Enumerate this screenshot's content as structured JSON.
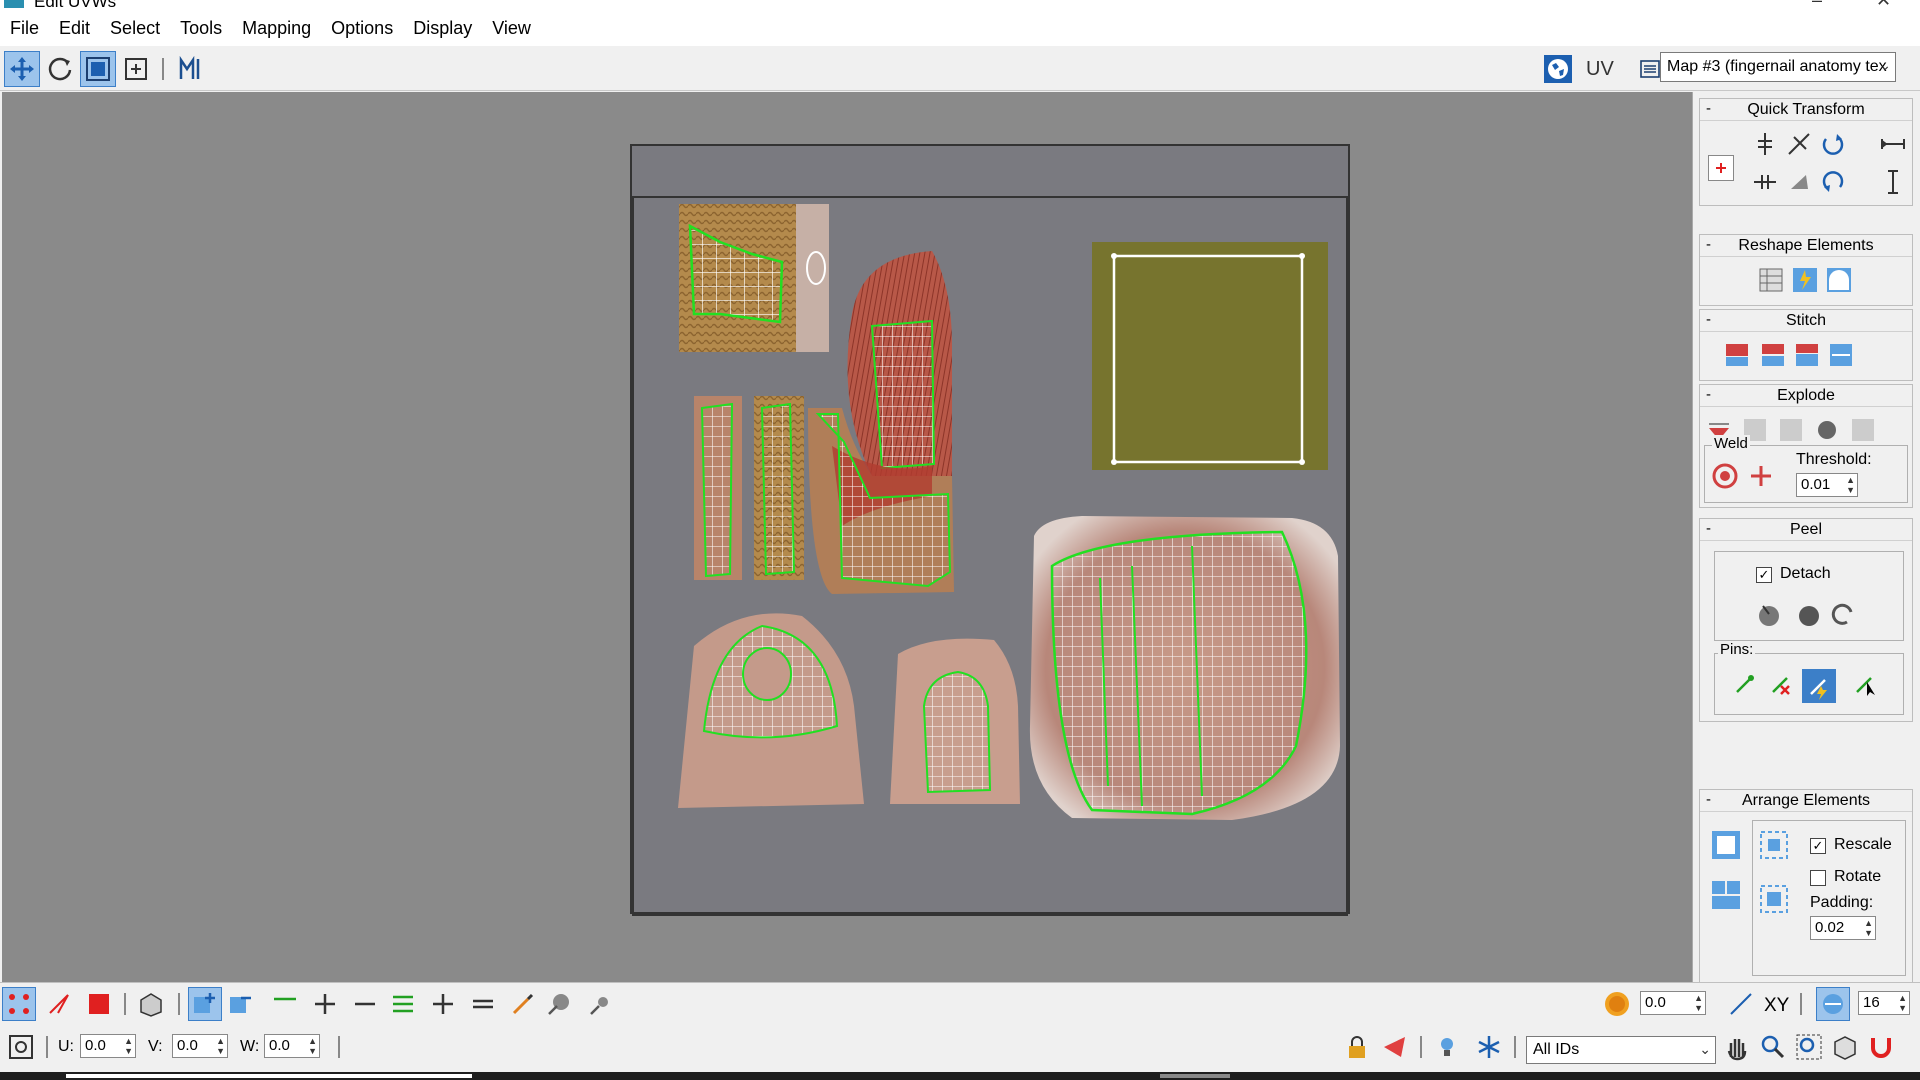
{
  "window": {
    "title": "Edit UVWs",
    "minimize_glyph": "–",
    "close_glyph": "✕"
  },
  "menu": [
    "File",
    "Edit",
    "Select",
    "Tools",
    "Mapping",
    "Options",
    "Display",
    "View"
  ],
  "toolbar": {
    "uv_label": "UV",
    "map_select": "Map #3 (fingernail anatomy tex",
    "icons": [
      "move-icon",
      "rotate-icon",
      "scale-icon",
      "freeform-icon",
      "mirror-icon"
    ]
  },
  "panel": {
    "quick_transform": {
      "title": "Quick Transform",
      "collapse": "-"
    },
    "reshape": {
      "title": "Reshape Elements",
      "collapse": "-"
    },
    "stitch": {
      "title": "Stitch",
      "collapse": "-"
    },
    "explode": {
      "title": "Explode",
      "collapse": "-"
    },
    "weld": {
      "label": "Weld",
      "threshold_label": "Threshold:",
      "threshold_value": "0.01"
    },
    "peel": {
      "title": "Peel",
      "collapse": "-",
      "detach_label": "Detach",
      "detach_checked": true,
      "pins_label": "Pins:"
    },
    "arrange": {
      "title": "Arrange Elements",
      "collapse": "-",
      "rescale_label": "Rescale",
      "rescale_checked": true,
      "rotate_label": "Rotate",
      "rotate_checked": false,
      "padding_label": "Padding:",
      "padding_value": "0.02"
    }
  },
  "bottom": {
    "softsel_value": "0.0",
    "xy_label": "XY",
    "grid_value": "16",
    "u_label": "U:",
    "u_value": "0.0",
    "v_label": "V:",
    "v_value": "0.0",
    "w_label": "W:",
    "w_value": "0.0",
    "ids_select": "All IDs"
  },
  "colors": {
    "uv_green": "#22e022",
    "uv_white": "#ffffff",
    "viewport_bg": "#8a8a8a",
    "texture_bg": "#7a7a80",
    "olive": "#77742e",
    "active_blue": "#9cc4ec"
  }
}
